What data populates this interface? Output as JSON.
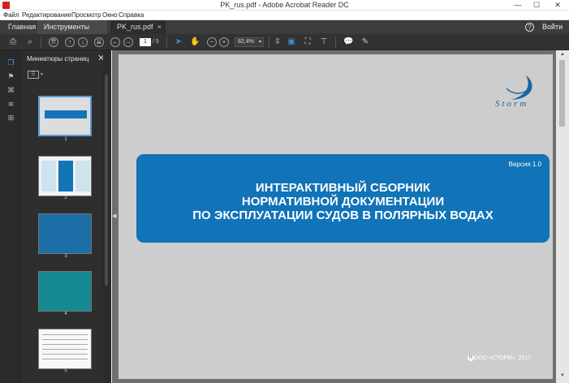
{
  "window": {
    "title": "PK_rus.pdf - Adobe Acrobat Reader DC",
    "controls": {
      "minimize": "—",
      "maximize": "☐",
      "close": "✕"
    }
  },
  "menu": {
    "items": [
      "Файл",
      "Редактирование",
      "Просмотр",
      "Окно",
      "Справка"
    ]
  },
  "tabs": {
    "home": "Главная",
    "tools": "Инструменты",
    "document": "PK_rus.pdf",
    "document_close": "×",
    "help": "?",
    "signin": "Войти"
  },
  "toolbar": {
    "page_current": "1",
    "page_total": "/ 5",
    "zoom": "82,4%",
    "zoom_caret": "▾"
  },
  "sidebar": {
    "title": "Миниатюры страниц",
    "close": "✕",
    "options_caret": "▾",
    "thumbnails": [
      {
        "number": "1"
      },
      {
        "number": "2"
      },
      {
        "number": "3"
      },
      {
        "number": "4"
      },
      {
        "number": "5"
      }
    ],
    "selected_page": 1
  },
  "document": {
    "version": "Версия 1.0",
    "headline_lines": [
      "ИНТЕРАКТИВНЫЙ СБОРНИК",
      "НОРМАТИВНОЙ ДОКУМЕНТАЦИИ",
      "ПО ЭКСПЛУАТАЦИИ СУДОВ В ПОЛЯРНЫХ ВОДАХ"
    ],
    "logo_text": "Storm",
    "copyright": "ООО «СТОРМ», 2017",
    "copyright_mark": "R"
  },
  "colors": {
    "accent_blue": "#1173b8",
    "page_bg": "#cdcdcd",
    "ui_dark": "#323232"
  }
}
